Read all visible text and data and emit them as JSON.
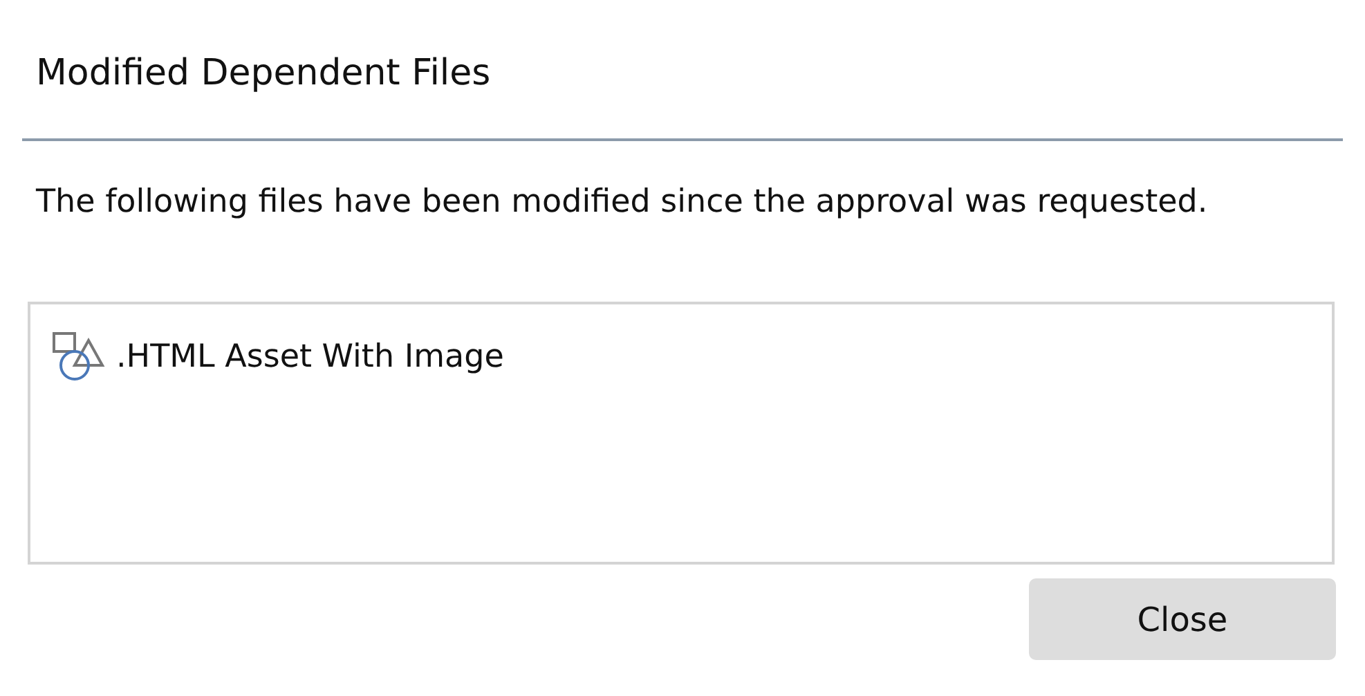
{
  "dialog": {
    "title": "Modified Dependent Files",
    "message": "The following files have been modified since the approval was requested.",
    "files": [
      {
        "name": ".HTML Asset With Image"
      }
    ],
    "buttons": [
      {
        "label": "Close"
      }
    ]
  }
}
